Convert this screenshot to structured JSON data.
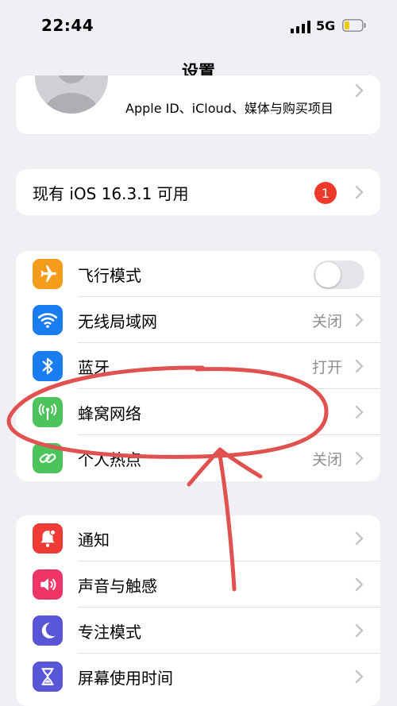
{
  "status_bar": {
    "time": "22:44",
    "network": "5G"
  },
  "nav": {
    "title": "设置"
  },
  "profile": {
    "subtitle": "Apple ID、iCloud、媒体与购买项目"
  },
  "update": {
    "label": "现有 iOS 16.3.1 可用",
    "badge": "1"
  },
  "group1": [
    {
      "label": "飞行模式",
      "icon": "airplane-icon",
      "color": "#f59c1c",
      "toggle_on": false
    },
    {
      "label": "无线局域网",
      "icon": "wifi-icon",
      "color": "#1a7cf1",
      "value": "关闭"
    },
    {
      "label": "蓝牙",
      "icon": "bluetooth-icon",
      "color": "#1a7cf1",
      "value": "打开"
    },
    {
      "label": "蜂窝网络",
      "icon": "cellular-icon",
      "color": "#4cc45c"
    },
    {
      "label": "个人热点",
      "icon": "hotspot-icon",
      "color": "#4cc45c",
      "value": "关闭"
    }
  ],
  "group2": [
    {
      "label": "通知",
      "icon": "notification-icon",
      "color": "#ee3b36"
    },
    {
      "label": "声音与触感",
      "icon": "sound-icon",
      "color": "#ee3566"
    },
    {
      "label": "专注模式",
      "icon": "moon-icon",
      "color": "#5856d6"
    },
    {
      "label": "屏幕使用时间",
      "icon": "hourglass-icon",
      "color": "#5856d6"
    }
  ],
  "annotation_color": "#e0524f"
}
